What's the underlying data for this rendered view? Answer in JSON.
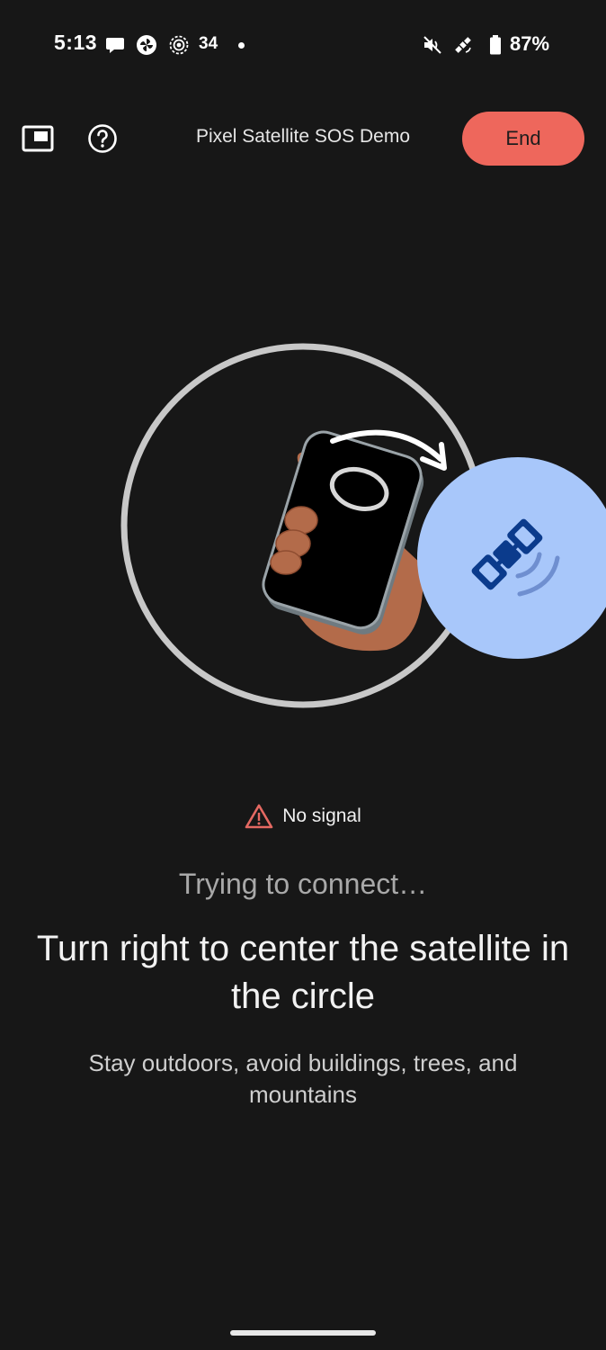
{
  "status_bar": {
    "time": "5:13",
    "notification_count": "34",
    "battery_percent": "87%",
    "icons": [
      "chat-icon",
      "pinwheel-icon",
      "hotspot-icon",
      "dot-icon",
      "mute-icon",
      "satellite-icon",
      "battery-icon"
    ]
  },
  "toolbar": {
    "pip_icon": "picture-in-picture-icon",
    "help_icon": "help-icon",
    "title": "Pixel Satellite SOS Demo",
    "end_label": "End"
  },
  "illustration": {
    "icons": [
      "target-circle",
      "hand-holding-phone",
      "rotate-right-arrow-icon",
      "satellite-icon"
    ],
    "colors": {
      "ring": "#c8c8c8",
      "satellite_bubble": "#a8c7fa",
      "satellite_glyph": "#0b3b8c",
      "hand": "#b36b4a",
      "end_button": "#ee675c"
    }
  },
  "signal": {
    "icon": "warning-triangle-icon",
    "label": "No signal",
    "color": "#e46962"
  },
  "connecting": "Trying to connect…",
  "instruction": "Turn right to center the satellite in the circle",
  "hint": "Stay outdoors, avoid buildings, trees, and mountains"
}
